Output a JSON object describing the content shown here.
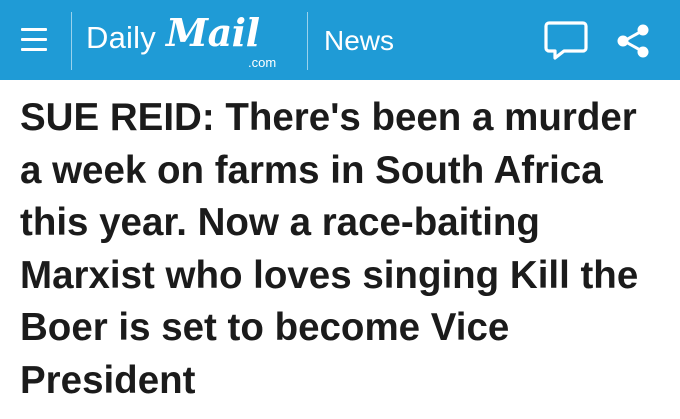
{
  "header": {
    "background_color": "#1f9bd6",
    "menu_icon": "hamburger-menu-icon",
    "logo": {
      "daily": "Daily",
      "mail": "Mail",
      "com": ".com"
    },
    "section_label": "News",
    "comment_icon": "comment-bubble-icon",
    "share_icon": "share-icon"
  },
  "article": {
    "headline": "SUE REID: There's been a murder a week on farms in South Africa this year. Now a race-baiting Marxist who loves singing Kill the Boer is set to become Vice President"
  }
}
